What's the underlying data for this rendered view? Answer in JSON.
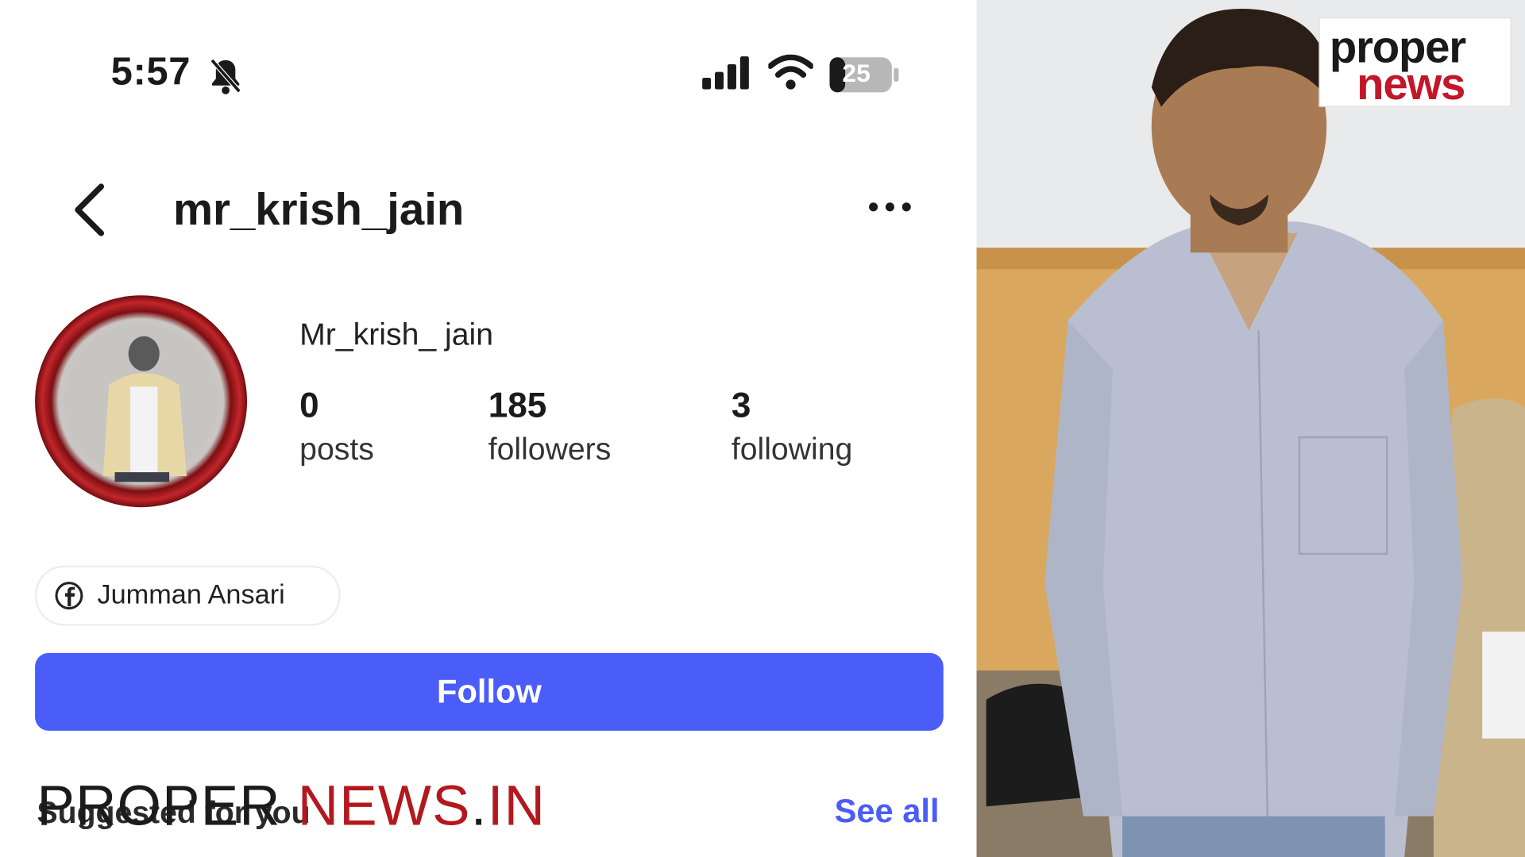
{
  "status_bar": {
    "time": "5:57",
    "battery": "25"
  },
  "header": {
    "username": "mr_krish_jain"
  },
  "profile": {
    "display_name": "Mr_krish_ jain",
    "stats": [
      {
        "value": "0",
        "label": "posts"
      },
      {
        "value": "185",
        "label": "followers"
      },
      {
        "value": "3",
        "label": "following"
      }
    ],
    "facebook_link": "Jumman Ansari"
  },
  "actions": {
    "follow_label": "Follow"
  },
  "suggested": {
    "title": "Suggested for you",
    "see_all": "See all"
  },
  "watermark": {
    "part1": "PROPER ",
    "part2": "NEWS",
    "part3": ".",
    "part4": "IN"
  },
  "logo": {
    "line1": "proper",
    "line2": "news"
  },
  "colors": {
    "accent": "#4a5df9",
    "brand_red": "#c0182a"
  },
  "icons": [
    "back-chevron-icon",
    "more-dots-icon",
    "bell-off-icon",
    "signal-icon",
    "wifi-icon",
    "battery-icon",
    "facebook-icon"
  ]
}
